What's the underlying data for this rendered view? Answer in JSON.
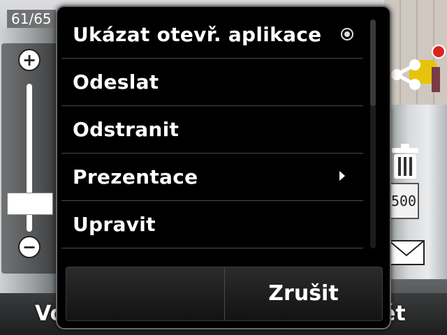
{
  "viewer": {
    "counter": "61/65",
    "plate_text": "500",
    "bottom_left_text": "Vo",
    "bottom_right_text": "ět",
    "zoom": {
      "plus": "+",
      "minus": "−",
      "level": 0.15
    },
    "icons": [
      "share-icon",
      "trash-icon",
      "mail-icon",
      "plus-icon",
      "minus-icon"
    ]
  },
  "menu": {
    "items": [
      {
        "label": "Ukázat otevř. aplikace",
        "indicator": "radio-selected"
      },
      {
        "label": "Odeslat",
        "indicator": ""
      },
      {
        "label": "Odstranit",
        "indicator": ""
      },
      {
        "label": "Prezentace",
        "indicator": "submenu-arrow"
      },
      {
        "label": "Upravit",
        "indicator": ""
      }
    ],
    "softkeys": {
      "left": "",
      "right": "Zrušit"
    }
  },
  "colors": {
    "menu_bg": "#000000",
    "text": "#ffffff",
    "divider": "#4a4a4a"
  }
}
